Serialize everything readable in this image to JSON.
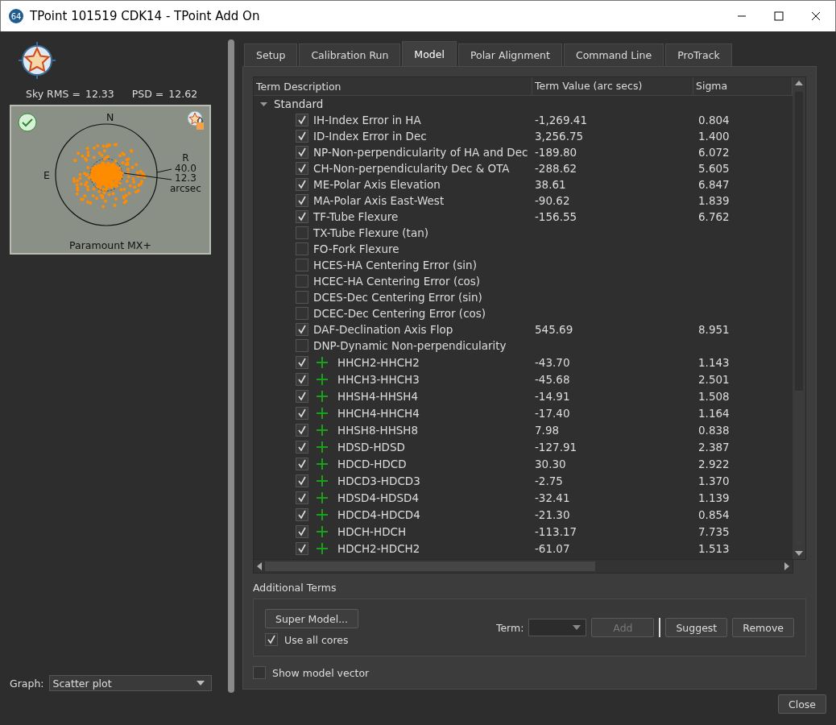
{
  "window": {
    "title": "TPoint 101519 CDK14 - TPoint Add On",
    "app_badge": "64"
  },
  "sidebar": {
    "sky_rms_label": "Sky RMS =",
    "sky_rms": "12.33",
    "psd_label": "PSD =",
    "psd": "12.62",
    "plot": {
      "north": "N",
      "east": "E",
      "radius_label": "R",
      "outer_radius": "40.0",
      "inner_radius": "12.3",
      "unit": "arcsec",
      "mount": "Paramount MX+",
      "fit_ok": true
    },
    "graph_label": "Graph:",
    "graph_value": "Scatter plot"
  },
  "tabs": [
    {
      "label": "Setup",
      "selected": false
    },
    {
      "label": "Calibration Run",
      "selected": false
    },
    {
      "label": "Model",
      "selected": true
    },
    {
      "label": "Polar Alignment",
      "selected": false
    },
    {
      "label": "Command Line",
      "selected": false
    },
    {
      "label": "ProTrack",
      "selected": false
    }
  ],
  "table": {
    "columns": [
      "Term Description",
      "Term Value (arc secs)",
      "Sigma"
    ],
    "groups": [
      {
        "label": "Standard",
        "expanded": true,
        "children": [
          {
            "kind": "standard",
            "checked": true,
            "term": "IH-Index Error in HA",
            "value": "-1,269.41",
            "sigma": "0.804"
          },
          {
            "kind": "standard",
            "checked": true,
            "term": "ID-Index Error in Dec",
            "value": "3,256.75",
            "sigma": "1.400"
          },
          {
            "kind": "standard",
            "checked": true,
            "term": "NP-Non-perpendicularity of HA and Dec",
            "value": "-189.80",
            "sigma": "6.072"
          },
          {
            "kind": "standard",
            "checked": true,
            "term": "CH-Non-perpendicularity Dec & OTA",
            "value": "-288.62",
            "sigma": "5.605"
          },
          {
            "kind": "standard",
            "checked": true,
            "term": "ME-Polar Axis Elevation",
            "value": "38.61",
            "sigma": "6.847"
          },
          {
            "kind": "standard",
            "checked": true,
            "term": "MA-Polar Axis East-West",
            "value": "-90.62",
            "sigma": "1.839"
          },
          {
            "kind": "standard",
            "checked": true,
            "term": "TF-Tube Flexure",
            "value": "-156.55",
            "sigma": "6.762"
          },
          {
            "kind": "standard",
            "checked": false,
            "term": "TX-Tube Flexure (tan)"
          },
          {
            "kind": "standard",
            "checked": false,
            "term": "FO-Fork Flexure"
          },
          {
            "kind": "standard",
            "checked": false,
            "term": "HCES-HA Centering Error (sin)"
          },
          {
            "kind": "standard",
            "checked": false,
            "term": "HCEC-HA Centering Error (cos)"
          },
          {
            "kind": "standard",
            "checked": false,
            "term": "DCES-Dec Centering Error (sin)"
          },
          {
            "kind": "standard",
            "checked": false,
            "term": "DCEC-Dec Centering Error (cos)"
          },
          {
            "kind": "standard",
            "checked": true,
            "term": "DAF-Declination Axis Flop",
            "value": "545.69",
            "sigma": "8.951"
          },
          {
            "kind": "standard",
            "checked": false,
            "term": "DNP-Dynamic Non-perpendicularity"
          },
          {
            "kind": "added",
            "checked": true,
            "term": "HHCH2-HHCH2",
            "value": "-43.70",
            "sigma": "1.143"
          },
          {
            "kind": "added",
            "checked": true,
            "term": "HHCH3-HHCH3",
            "value": "-45.68",
            "sigma": "2.501"
          },
          {
            "kind": "added",
            "checked": true,
            "term": "HHSH4-HHSH4",
            "value": "-14.91",
            "sigma": "1.508"
          },
          {
            "kind": "added",
            "checked": true,
            "term": "HHCH4-HHCH4",
            "value": "-17.40",
            "sigma": "1.164"
          },
          {
            "kind": "added",
            "checked": true,
            "term": "HHSH8-HHSH8",
            "value": "7.98",
            "sigma": "0.838"
          },
          {
            "kind": "added",
            "checked": true,
            "term": "HDSD-HDSD",
            "value": "-127.91",
            "sigma": "2.387"
          },
          {
            "kind": "added",
            "checked": true,
            "term": "HDCD-HDCD",
            "value": "30.30",
            "sigma": "2.922"
          },
          {
            "kind": "added",
            "checked": true,
            "term": "HDCD3-HDCD3",
            "value": "-2.75",
            "sigma": "1.370"
          },
          {
            "kind": "added",
            "checked": true,
            "term": "HDSD4-HDSD4",
            "value": "-32.41",
            "sigma": "1.139"
          },
          {
            "kind": "added",
            "checked": true,
            "term": "HDCD4-HDCD4",
            "value": "-21.30",
            "sigma": "0.854"
          },
          {
            "kind": "added",
            "checked": true,
            "term": "HDCH-HDCH",
            "value": "-113.17",
            "sigma": "7.735"
          },
          {
            "kind": "added",
            "checked": true,
            "term": "HDCH2-HDCH2",
            "value": "-61.07",
            "sigma": "1.513"
          }
        ]
      }
    ]
  },
  "additional_terms": {
    "title": "Additional Terms",
    "super_model": "Super Model...",
    "use_all_cores": {
      "label": "Use all cores",
      "checked": true
    },
    "term_label": "Term:",
    "add": {
      "label": "Add",
      "disabled": true
    },
    "suggest": "Suggest",
    "remove": "Remove"
  },
  "show_model_vector": {
    "label": "Show model vector",
    "checked": false
  },
  "close": "Close"
}
